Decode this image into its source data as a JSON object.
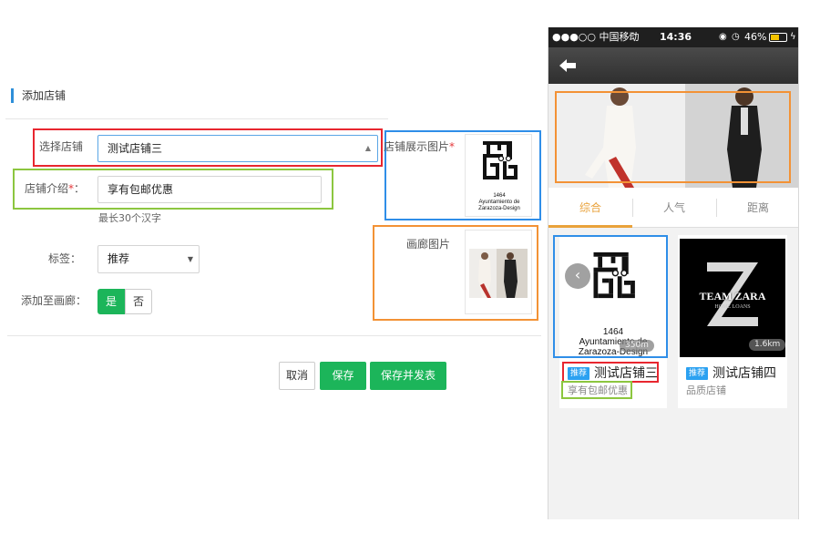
{
  "form": {
    "section_title": "添加店铺",
    "store": {
      "label": "选择店铺",
      "value": "测试店铺三"
    },
    "intro": {
      "label": "店铺介绍",
      "required_mark": "*",
      "separator": "：",
      "value": "享有包邮优惠",
      "hint": "最长30个汉字"
    },
    "display_image": {
      "label": "店铺展示图片",
      "required_mark": "*"
    },
    "gallery_image": {
      "label": "画廊图片"
    },
    "tag": {
      "label": "标签：",
      "value": "推荐"
    },
    "add_to_gallery": {
      "label": "添加至画廊：",
      "yes": "是",
      "no": "否"
    },
    "buttons": {
      "cancel": "取消",
      "save": "保存",
      "save_publish": "保存并发表"
    },
    "logo": {
      "year": "1464",
      "line1": "Ayuntamiento de",
      "line2": "Zarazoza-Design"
    }
  },
  "phone": {
    "status_bar": {
      "carrier": "●●●○○ 中国移动",
      "time": "14:36",
      "battery": "46%"
    },
    "tabs": [
      "综合",
      "人气",
      "距离"
    ],
    "active_tab": 0,
    "cards": [
      {
        "badge": "推荐",
        "name": "测试店铺三",
        "desc": "享有包邮优惠",
        "distance": "350m",
        "logo": {
          "year": "1464",
          "line1": "Ayuntamiento de",
          "line2": "Zarazoza-Design"
        }
      },
      {
        "badge": "推荐",
        "name": "测试店铺四",
        "desc": "品质店铺",
        "distance": "1.6km",
        "logo": {
          "title": "TEAM ZARA",
          "sub": "HOME LOANS"
        }
      }
    ]
  },
  "colors": {
    "accent_green": "#1cb55a",
    "badge_blue": "#2ba1f1",
    "highlight_red": "#e8262f",
    "highlight_green": "#8cc63f",
    "highlight_blue": "#2f8ee8",
    "highlight_orange": "#f39235",
    "tab_active": "#e9a23b"
  }
}
